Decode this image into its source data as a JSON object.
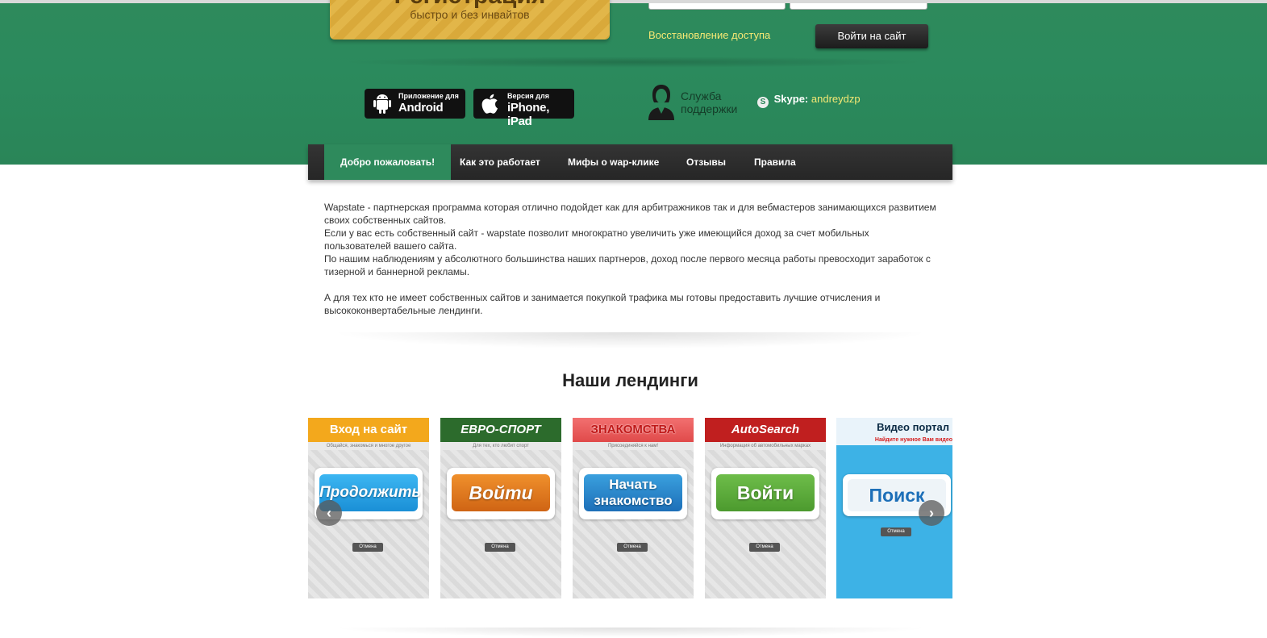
{
  "header": {
    "register_title": "Регистрация",
    "register_subtitle": "быстро и без инвайтов",
    "restore_link": "Восстановление доступа",
    "login_button": "Войти на сайт"
  },
  "apps": [
    {
      "line1": "Приложение для",
      "line2": "Android",
      "icon": "android-icon"
    },
    {
      "line1": "Версия для",
      "line2": "iPhone, iPad",
      "icon": "apple-icon"
    }
  ],
  "support": {
    "line1": "Служба",
    "line2": "поддержки",
    "skype_label": "Skype:",
    "skype_nick": "andreydzp"
  },
  "nav": [
    {
      "label": "Добро пожаловать!",
      "active": true
    },
    {
      "label": "Как это работает"
    },
    {
      "label": "Мифы о wap-клике"
    },
    {
      "label": "Отзывы"
    },
    {
      "label": "Правила"
    }
  ],
  "intro": {
    "p1": "Wapstate - партнерская программа которая отлично подойдет как для арбитражников так и для вебмастеров занимающихся развитием своих собственных сайтов.",
    "p2": "Если у вас есть собственный сайт - wapstate позволит многократно увеличить уже имеющийся доход за счет мобильных пользователей вашего сайта.",
    "p3": "По нашим наблюдениям у абсолютного большинства наших партнеров, доход после первого месяца работы превосходит заработок с тизерной и баннерной рекламы.",
    "p4": "А для тех кто не имеет собственных сайтов и занимается покупкой трафика мы готовы предоставить лучшие отчисления и высококонвертабельные лендинги."
  },
  "landings_title": "Наши лендинги",
  "landings": [
    {
      "title": "Вход на сайт",
      "subtitle": "Общайся, знакомься и многое другое",
      "cta": "Продолжить",
      "cancel": "Отмена",
      "head_color": "#f3a81c",
      "cta_color": "#1e9ee6"
    },
    {
      "title": "ЕВРО-СПОРТ",
      "subtitle": "Для тех, кто любит спорт",
      "cta": "Войти",
      "cancel": "Отмена",
      "head_color": "#2c6b2c",
      "cta_color": "#e0761c"
    },
    {
      "title": "ЗНАКОМСТВА",
      "subtitle": "Присоединяйся к нам!",
      "cta": "Начать знакомство",
      "cancel": "Отмена",
      "head_color": "#e04a4a",
      "cta_color": "#1d87c8"
    },
    {
      "title": "AutoSearch",
      "subtitle": "Информация об автомобильных марках",
      "cta": "Войти",
      "cancel": "Отмена",
      "head_color": "#c01f1f",
      "cta_color": "#5aa83a"
    },
    {
      "title": "Видео портал",
      "subtitle": "Найдите нужное Вам видео",
      "cta": "Поиск",
      "cancel": "Отмена",
      "head_color": "#34a8dc",
      "cta_color": "#dfe9f0"
    }
  ],
  "carousel": {
    "prev": "‹",
    "next": "›"
  }
}
